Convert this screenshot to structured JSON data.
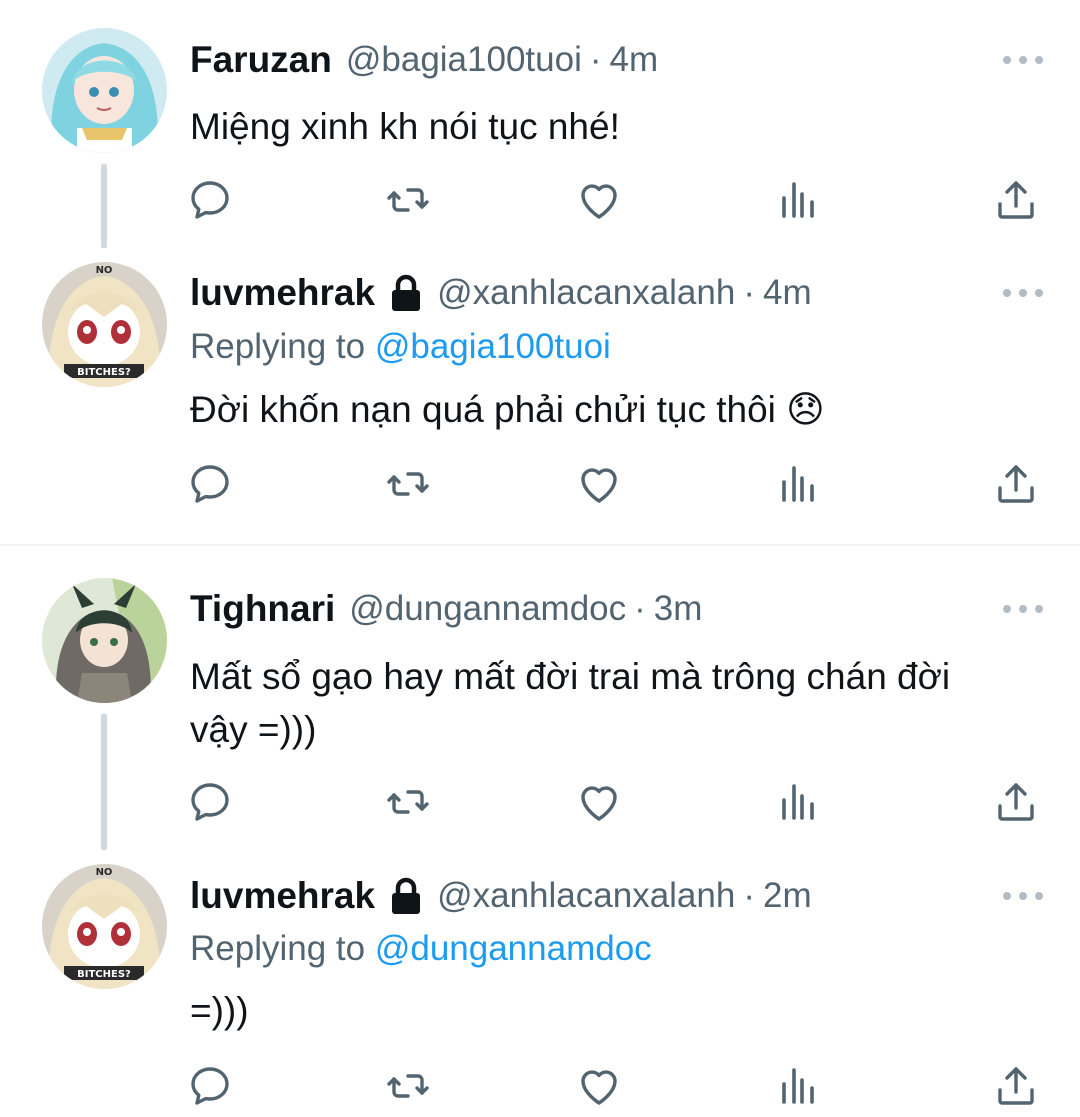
{
  "tweets": [
    {
      "name": "Faruzan",
      "handle": "@bagia100tuoi",
      "time": "4m",
      "text": "Miệng xinh kh nói tục nhé!",
      "locked": false
    },
    {
      "name": "luvmehrak",
      "handle": "@xanhlacanxalanh",
      "time": "4m",
      "replying_prefix": "Replying to ",
      "replying_to": "@bagia100tuoi",
      "text": "Đời khốn nạn quá phải chửi tục thôi 😞",
      "locked": true
    },
    {
      "name": "Tighnari",
      "handle": "@dungannamdoc",
      "time": "3m",
      "text": "Mất sổ gạo hay mất đời trai mà trông chán đời vậy =)))",
      "locked": false
    },
    {
      "name": "luvmehrak",
      "handle": "@xanhlacanxalanh",
      "time": "2m",
      "replying_prefix": "Replying to ",
      "replying_to": "@dungannamdoc",
      "text": "=)))",
      "locked": true
    }
  ],
  "separator": "·",
  "action_icons": [
    "reply-icon",
    "retweet-icon",
    "like-icon",
    "analytics-icon",
    "share-icon"
  ],
  "colors": {
    "text": "#0f1419",
    "secondary": "#536471",
    "link": "#1d9bf0",
    "icon": "#536471",
    "thread_line": "#cfd9de"
  }
}
